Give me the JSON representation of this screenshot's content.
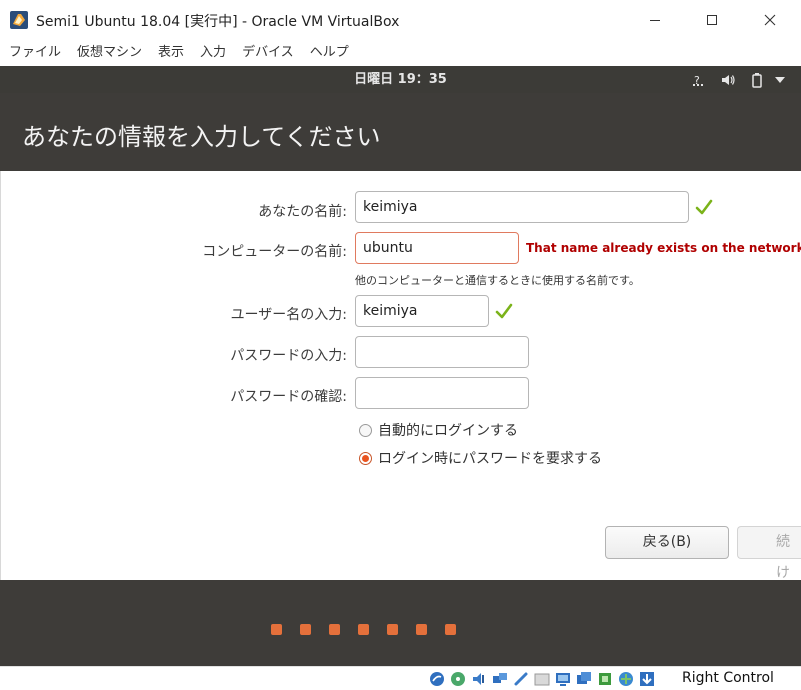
{
  "window": {
    "title": "Semi1 Ubuntu 18.04 [実行中] - Oracle VM VirtualBox"
  },
  "menubar": {
    "items": [
      "ファイル",
      "仮想マシン",
      "表示",
      "入力",
      "デバイス",
      "ヘルプ"
    ]
  },
  "topbar": {
    "clock": "日曜日 19：35",
    "tray_icons": [
      "network-icon",
      "volume-icon",
      "battery-icon",
      "menu-arrow-icon"
    ]
  },
  "installer": {
    "title": "あなたの情報を入力してください",
    "name_label": "あなたの名前:",
    "name_value": "keimiya",
    "computer_label": "コンピューターの名前:",
    "computer_value": "ubuntu",
    "computer_error": "That name already exists on the network.",
    "computer_hint": "他のコンピューターと通信するときに使用する名前です。",
    "username_label": "ユーザー名の入力:",
    "username_value": "keimiya",
    "password_label": "パスワードの入力:",
    "password_value": "",
    "confirm_label": "パスワードの確認:",
    "confirm_value": "",
    "login_options": [
      {
        "label": "自動的にログインする",
        "selected": false
      },
      {
        "label": "ログイン時にパスワードを要求する",
        "selected": true
      }
    ],
    "back_button": "戻る(B)",
    "continue_button": "続け"
  },
  "progress": {
    "steps_total": 7
  },
  "statusbar": {
    "host_key": "Right Control"
  },
  "colors": {
    "ubuntu_dark": "#3e3c39",
    "ubuntu_orange": "#e95420",
    "progress_dot": "#e4703b",
    "error_text": "#b00000",
    "check_green": "#7bb31a"
  }
}
